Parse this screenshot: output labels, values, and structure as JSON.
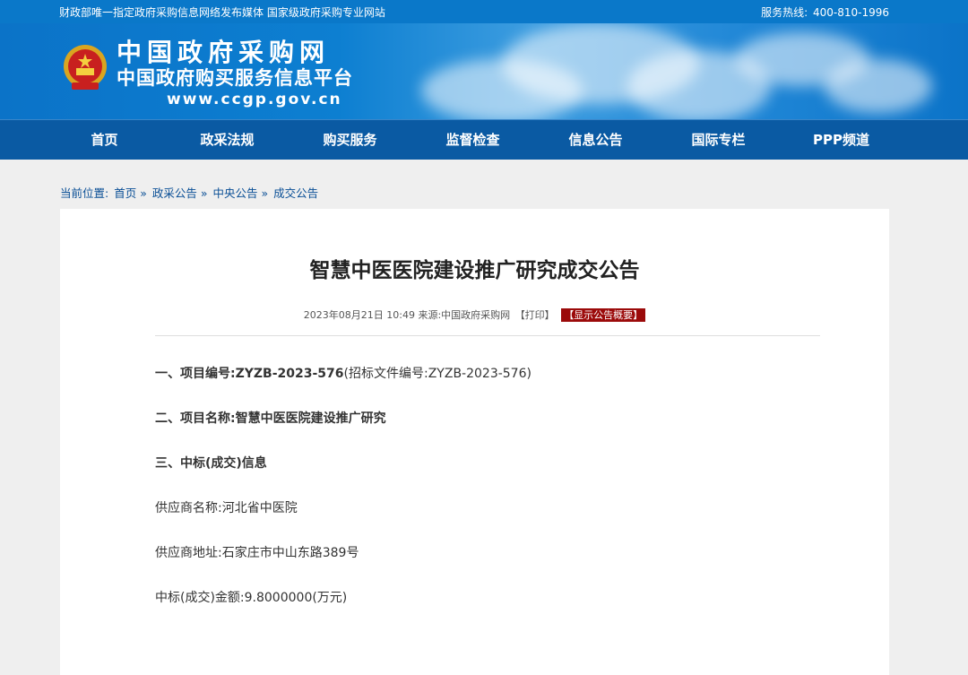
{
  "topbar": {
    "slogan": "财政部唯一指定政府采购信息网络发布媒体 国家级政府采购专业网站",
    "hotline_label": "服务热线:",
    "hotline_number": "400-810-1996"
  },
  "banner": {
    "title_line1": "中国政府采购网",
    "title_line2": "中国政府购买服务信息平台",
    "url": "www.ccgp.gov.cn",
    "colors": {
      "primary": "#0a78c9",
      "nav": "#0a5aa3",
      "accent_red": "#9b0a0a"
    }
  },
  "nav": {
    "items": [
      "首页",
      "政采法规",
      "购买服务",
      "监督检查",
      "信息公告",
      "国际专栏",
      "PPP频道"
    ]
  },
  "breadcrumb": {
    "label": "当前位置:",
    "items": [
      "首页",
      "政采公告",
      "中央公告",
      "成交公告"
    ],
    "separator": "»"
  },
  "article": {
    "title": "智慧中医医院建设推广研究成交公告",
    "meta": "2023年08月21日 10:49 来源:中国政府采购网",
    "print_label": "【打印】",
    "summary_label": "【显示公告概要】",
    "rows": [
      {
        "label": "一、项目编号:ZYZB-2023-576",
        "extra": "(招标文件编号:ZYZB-2023-576)",
        "bold": true
      },
      {
        "label": "二、项目名称:智慧中医医院建设推广研究",
        "extra": "",
        "bold": true
      },
      {
        "label": "三、中标(成交)信息",
        "extra": "",
        "bold": true
      },
      {
        "label": "供应商名称:河北省中医院",
        "extra": "",
        "bold": false
      },
      {
        "label": "供应商地址:石家庄市中山东路389号",
        "extra": "",
        "bold": false
      },
      {
        "label": "中标(成交)金额:9.8000000(万元)",
        "extra": "",
        "bold": false
      }
    ]
  }
}
